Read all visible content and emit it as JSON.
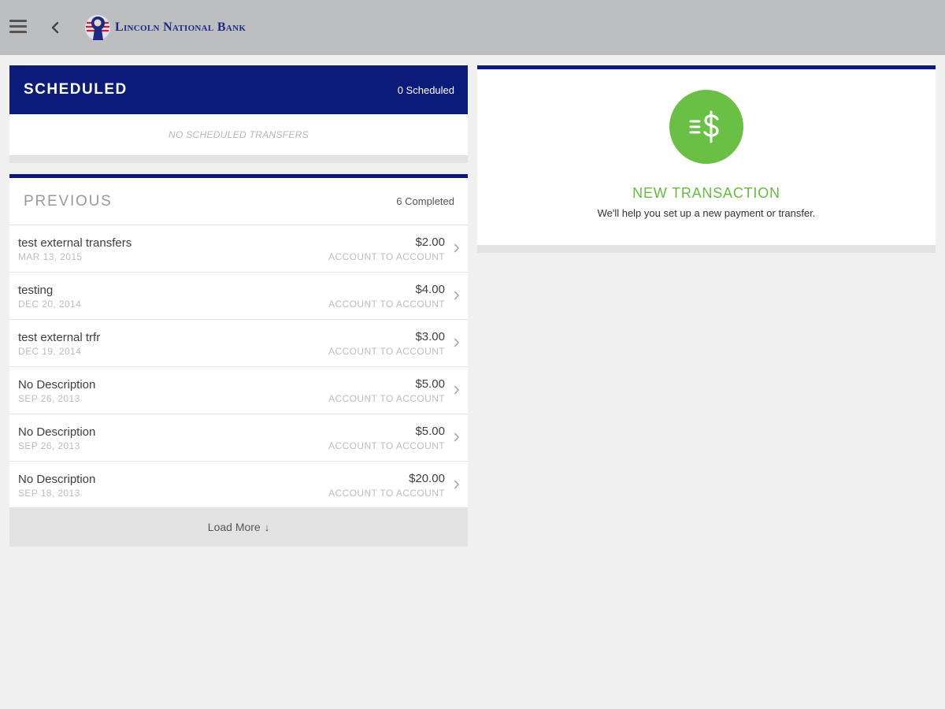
{
  "header": {
    "brand_name": "Lincoln National Bank",
    "brand_color": "#1c2a86",
    "icons": [
      "menu-icon",
      "back-chevron-icon"
    ]
  },
  "scheduled": {
    "title": "SCHEDULED",
    "count_label": "0 Scheduled",
    "empty_message": "NO SCHEDULED TRANSFERS",
    "header_color": "#0c1b7a"
  },
  "previous": {
    "title": "PREVIOUS",
    "count_label": "6 Completed",
    "items": [
      {
        "description": "test external transfers",
        "date": "MAR 13, 2015",
        "amount": "$2.00",
        "type": "ACCOUNT TO ACCOUNT"
      },
      {
        "description": "testing",
        "date": "DEC 20, 2014",
        "amount": "$4.00",
        "type": "ACCOUNT TO ACCOUNT"
      },
      {
        "description": "test external trfr",
        "date": "DEC 19, 2014",
        "amount": "$3.00",
        "type": "ACCOUNT TO ACCOUNT"
      },
      {
        "description": "No Description",
        "date": "SEP 26, 2013",
        "amount": "$5.00",
        "type": "ACCOUNT TO ACCOUNT"
      },
      {
        "description": "No Description",
        "date": "SEP 26, 2013",
        "amount": "$5.00",
        "type": "ACCOUNT TO ACCOUNT"
      },
      {
        "description": "No Description",
        "date": "SEP 18, 2013",
        "amount": "$20.00",
        "type": "ACCOUNT TO ACCOUNT"
      }
    ],
    "load_more_label": "Load More"
  },
  "new_transaction": {
    "title": "NEW TRANSACTION",
    "subtitle": "We'll help you set up a new payment or transfer.",
    "icon": "dollar-transfer-icon",
    "accent_color": "#6abf45"
  }
}
